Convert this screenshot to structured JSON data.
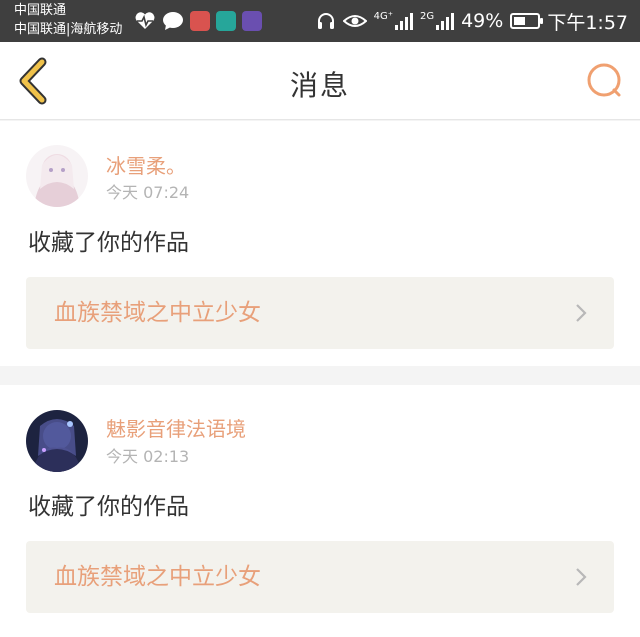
{
  "status_bar": {
    "carrier_line1": "中国联通",
    "carrier_line2": "中国联通|海航移动",
    "network_4g": "4G⁺",
    "network_2g": "2G",
    "battery_text": "49%",
    "battery_level": 0.49,
    "time": "下午1:57",
    "icons": [
      "heart-pulse-icon",
      "chat-bubble-icon",
      "app-icon-red",
      "app-icon-teal",
      "app-icon-purple",
      "headphones-icon",
      "eye-icon"
    ]
  },
  "nav": {
    "title": "消息",
    "back_icon": "chevron-left-icon",
    "search_icon": "search-icon"
  },
  "colors": {
    "accent": "#e8a07a",
    "nav_icon": "#f0c24a",
    "search_icon": "#f0a070"
  },
  "messages": [
    {
      "username": "冰雪柔。",
      "time": "今天 07:24",
      "action": "收藏了你的作品",
      "work_title": "血族禁域之中立少女"
    },
    {
      "username": "魅影音律法语境",
      "time": "今天 02:13",
      "action": "收藏了你的作品",
      "work_title": "血族禁域之中立少女"
    }
  ]
}
